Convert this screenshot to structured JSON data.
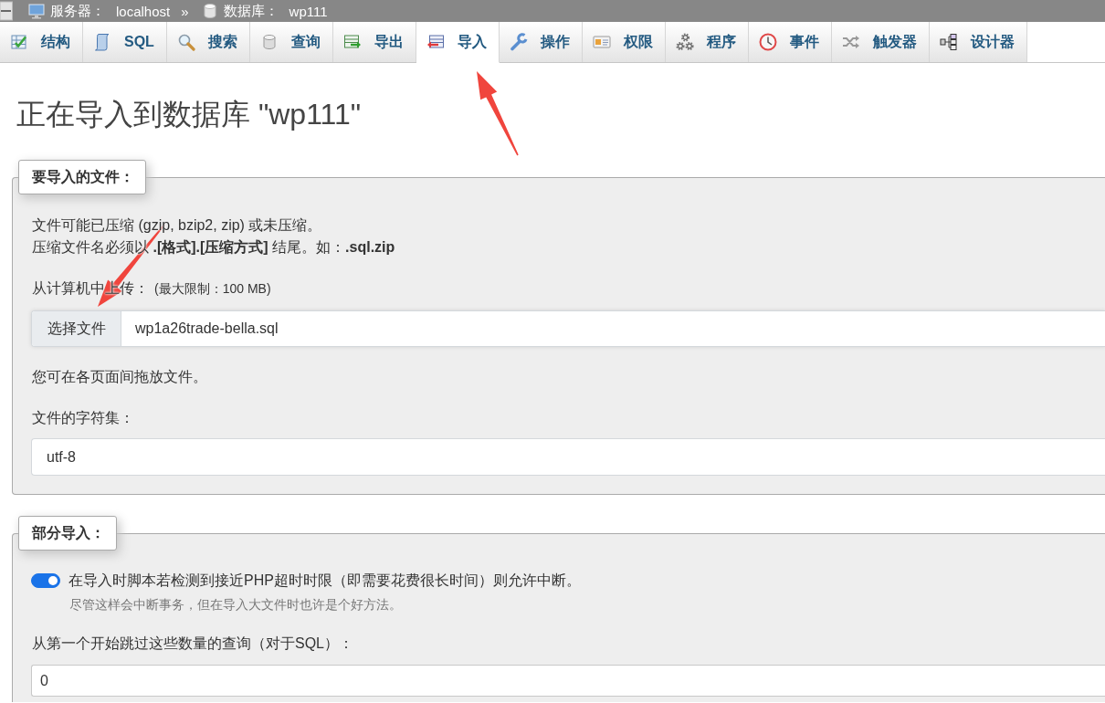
{
  "breadcrumb": {
    "items": [
      {
        "kind": "server",
        "label": "服务器：",
        "value": "localhost"
      },
      {
        "kind": "database",
        "label": "数据库：",
        "value": "wp111"
      }
    ],
    "separator": "»"
  },
  "tabs": [
    {
      "kind": "structure",
      "label": "结构",
      "selected": false
    },
    {
      "kind": "sql",
      "label": "SQL",
      "selected": false
    },
    {
      "kind": "search",
      "label": "搜索",
      "selected": false
    },
    {
      "kind": "query",
      "label": "查询",
      "selected": false
    },
    {
      "kind": "export",
      "label": "导出",
      "selected": false
    },
    {
      "kind": "import",
      "label": "导入",
      "selected": true
    },
    {
      "kind": "operations",
      "label": "操作",
      "selected": false
    },
    {
      "kind": "privileges",
      "label": "权限",
      "selected": false
    },
    {
      "kind": "routines",
      "label": "程序",
      "selected": false
    },
    {
      "kind": "events",
      "label": "事件",
      "selected": false
    },
    {
      "kind": "triggers",
      "label": "触发器",
      "selected": false
    },
    {
      "kind": "designer",
      "label": "设计器",
      "selected": false
    }
  ],
  "heading": "正在导入到数据库 \"wp111\"",
  "sections": [
    {
      "legend": "要导入的文件：",
      "items": [
        {
          "kind": "paragraph",
          "text": "文件可能已压缩 (gzip, bzip2, zip) 或未压缩。"
        },
        {
          "kind": "paragraph",
          "text": "压缩文件名必须以 **.[格式].[压缩方式]** 结尾。如：**.sql.zip**"
        },
        {
          "kind": "upload",
          "label": "从计算机中上传：",
          "note": "(最大限制：100 MB)",
          "button": "选择文件",
          "value": "wp1a26trade-bella.sql"
        },
        {
          "kind": "note",
          "text": "您可在各页面间拖放文件。"
        },
        {
          "kind": "select",
          "label": "文件的字符集：",
          "value": "utf-8"
        }
      ]
    },
    {
      "legend": "部分导入：",
      "items": [
        {
          "kind": "toggle",
          "on": true,
          "label": "在导入时脚本若检测到接近PHP超时时限（即需要花费很长时间）则允许中断。",
          "hint": "尽管这样会中断事务，但在导入大文件时也许是个好方法。"
        },
        {
          "kind": "number",
          "label": "从第一个开始跳过这些数量的查询（对于SQL）：",
          "value": "0"
        }
      ]
    }
  ]
}
